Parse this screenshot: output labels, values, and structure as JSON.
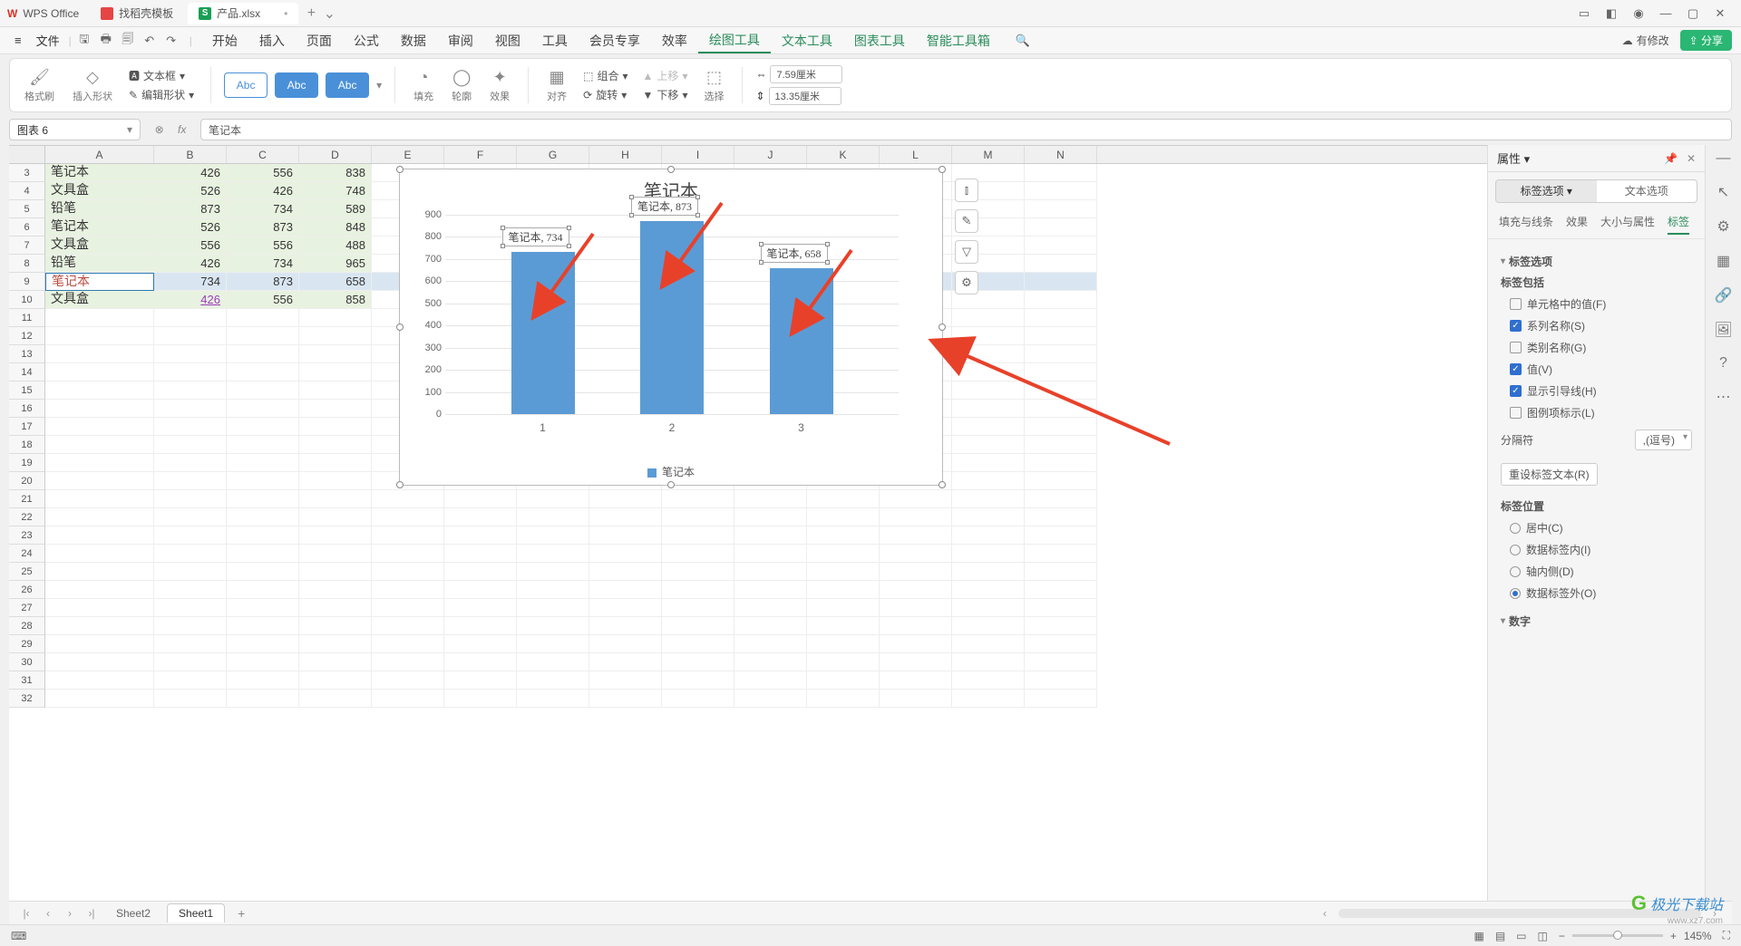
{
  "app": {
    "name": "WPS Office"
  },
  "tabs": [
    {
      "label": "找稻壳模板"
    },
    {
      "label": "产品.xlsx",
      "active": true,
      "icon": "S"
    }
  ],
  "window_controls": {
    "add": "+",
    "more": "⌄"
  },
  "file_menu": "文件",
  "menus": [
    "开始",
    "插入",
    "页面",
    "公式",
    "数据",
    "审阅",
    "视图",
    "工具",
    "会员专享",
    "效率",
    "绘图工具",
    "文本工具",
    "图表工具",
    "智能工具箱"
  ],
  "menu_active": "绘图工具",
  "top_right": {
    "modified": "有修改",
    "share": "分享"
  },
  "ribbon": {
    "brush": "格式刷",
    "insert_shape": "插入形状",
    "edit_shape": "编辑形状",
    "text_box": "文本框",
    "abc": "Abc",
    "fill": "填充",
    "outline": "轮廓",
    "effect": "效果",
    "align": "对齐",
    "group": "组合",
    "rotate": "旋转",
    "up": "上移",
    "down": "下移",
    "select": "选择",
    "size_w": "7.59厘米",
    "size_h": "13.35厘米"
  },
  "name_box": "图表 6",
  "formula": "笔记本",
  "columns": [
    "A",
    "B",
    "C",
    "D",
    "E",
    "F",
    "G",
    "H",
    "I",
    "J",
    "K",
    "L",
    "M",
    "N"
  ],
  "row_start": 3,
  "rows_count": 30,
  "cells": {
    "3": {
      "A": "笔记本",
      "B": "426",
      "C": "556",
      "D": "838"
    },
    "4": {
      "A": "文具盒",
      "B": "526",
      "C": "426",
      "D": "748"
    },
    "5": {
      "A": "铅笔",
      "B": "873",
      "C": "734",
      "D": "589"
    },
    "6": {
      "A": "笔记本",
      "B": "526",
      "C": "873",
      "D": "848"
    },
    "7": {
      "A": "文具盒",
      "B": "556",
      "C": "556",
      "D": "488"
    },
    "8": {
      "A": "铅笔",
      "B": "426",
      "C": "734",
      "D": "965"
    },
    "9": {
      "A": "笔记本",
      "B": "734",
      "C": "873",
      "D": "658"
    },
    "10": {
      "A": "文具盒",
      "B": "426",
      "C": "556",
      "D": "858"
    }
  },
  "link_cell": "426",
  "chart_data": {
    "type": "bar",
    "title": "笔记本",
    "categories": [
      "1",
      "2",
      "3"
    ],
    "values": [
      734,
      873,
      658
    ],
    "series_name": "笔记本",
    "ylim": [
      0,
      900
    ],
    "ytick": 100,
    "data_labels": [
      "笔记本, 734",
      "笔记本, 873",
      "笔记本, 658"
    ],
    "legend": "笔记本"
  },
  "chart_side_buttons": [
    "chart-elements",
    "chart-style",
    "chart-filter",
    "chart-settings"
  ],
  "panel": {
    "title": "属性",
    "tabs": [
      "标签选项",
      "文本选项"
    ],
    "sub_tabs": [
      "填充与线条",
      "效果",
      "大小与属性",
      "标签"
    ],
    "sub_active": "标签",
    "section_options": "标签选项",
    "label_includes": "标签包括",
    "chk_cell_val": "单元格中的值(F)",
    "chk_series": "系列名称(S)",
    "chk_category": "类别名称(G)",
    "chk_value": "值(V)",
    "chk_leader": "显示引导线(H)",
    "chk_legend_key": "图例项标示(L)",
    "separator_label": "分隔符",
    "separator_value": ",(逗号)",
    "reset_label": "重设标签文本(R)",
    "position_title": "标签位置",
    "rad_center": "居中(C)",
    "rad_inside": "数据标签内(I)",
    "rad_axis": "轴内侧(D)",
    "rad_outside": "数据标签外(O)",
    "number_title": "数字"
  },
  "sheets": {
    "s1": "Sheet2",
    "s2": "Sheet1"
  },
  "status": {
    "zoom": "145%"
  },
  "watermark": {
    "brand": "极光下载站",
    "url": "www.xz7.com"
  }
}
